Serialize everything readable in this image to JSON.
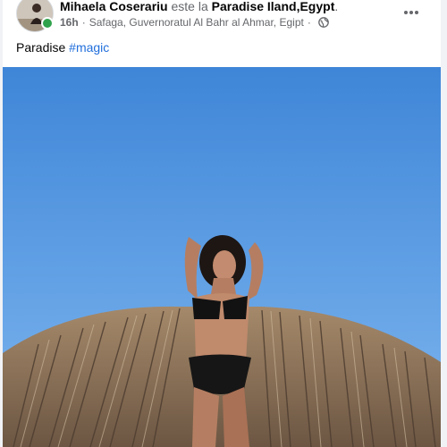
{
  "post": {
    "author_name": "Mihaela Coserariu",
    "is_at_text": "este la",
    "place_name": "Paradise Iland,Egypt",
    "period": ".",
    "time": "16h",
    "location": "Safaga, Guvernoratul Al Bahr al Ahmar, Egipt",
    "dot": "·",
    "privacy_icon": "globe-icon",
    "more_label": "•••",
    "caption_text": "Paradise ",
    "hashtag": "#magic"
  },
  "colors": {
    "sky_top": "#3f86d8",
    "sky_bottom": "#7eb6ef",
    "online": "#31a24c",
    "link": "#216fdb"
  }
}
